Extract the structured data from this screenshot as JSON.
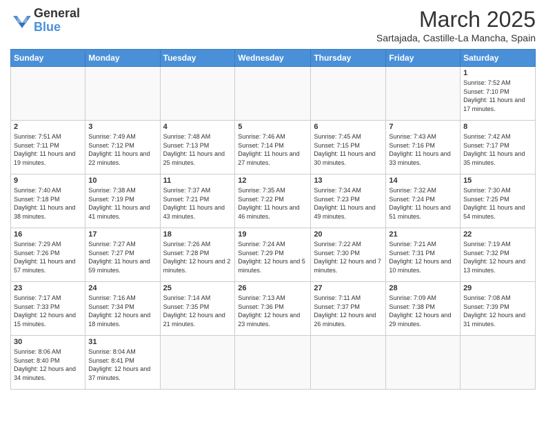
{
  "logo": {
    "text_general": "General",
    "text_blue": "Blue"
  },
  "header": {
    "month_title": "March 2025",
    "location": "Sartajada, Castille-La Mancha, Spain"
  },
  "weekdays": [
    "Sunday",
    "Monday",
    "Tuesday",
    "Wednesday",
    "Thursday",
    "Friday",
    "Saturday"
  ],
  "weeks": [
    [
      {
        "num": "",
        "info": ""
      },
      {
        "num": "",
        "info": ""
      },
      {
        "num": "",
        "info": ""
      },
      {
        "num": "",
        "info": ""
      },
      {
        "num": "",
        "info": ""
      },
      {
        "num": "",
        "info": ""
      },
      {
        "num": "1",
        "info": "Sunrise: 7:52 AM\nSunset: 7:10 PM\nDaylight: 11 hours\nand 17 minutes."
      }
    ],
    [
      {
        "num": "2",
        "info": "Sunrise: 7:51 AM\nSunset: 7:11 PM\nDaylight: 11 hours\nand 19 minutes."
      },
      {
        "num": "3",
        "info": "Sunrise: 7:49 AM\nSunset: 7:12 PM\nDaylight: 11 hours\nand 22 minutes."
      },
      {
        "num": "4",
        "info": "Sunrise: 7:48 AM\nSunset: 7:13 PM\nDaylight: 11 hours\nand 25 minutes."
      },
      {
        "num": "5",
        "info": "Sunrise: 7:46 AM\nSunset: 7:14 PM\nDaylight: 11 hours\nand 27 minutes."
      },
      {
        "num": "6",
        "info": "Sunrise: 7:45 AM\nSunset: 7:15 PM\nDaylight: 11 hours\nand 30 minutes."
      },
      {
        "num": "7",
        "info": "Sunrise: 7:43 AM\nSunset: 7:16 PM\nDaylight: 11 hours\nand 33 minutes."
      },
      {
        "num": "8",
        "info": "Sunrise: 7:42 AM\nSunset: 7:17 PM\nDaylight: 11 hours\nand 35 minutes."
      }
    ],
    [
      {
        "num": "9",
        "info": "Sunrise: 7:40 AM\nSunset: 7:18 PM\nDaylight: 11 hours\nand 38 minutes."
      },
      {
        "num": "10",
        "info": "Sunrise: 7:38 AM\nSunset: 7:19 PM\nDaylight: 11 hours\nand 41 minutes."
      },
      {
        "num": "11",
        "info": "Sunrise: 7:37 AM\nSunset: 7:21 PM\nDaylight: 11 hours\nand 43 minutes."
      },
      {
        "num": "12",
        "info": "Sunrise: 7:35 AM\nSunset: 7:22 PM\nDaylight: 11 hours\nand 46 minutes."
      },
      {
        "num": "13",
        "info": "Sunrise: 7:34 AM\nSunset: 7:23 PM\nDaylight: 11 hours\nand 49 minutes."
      },
      {
        "num": "14",
        "info": "Sunrise: 7:32 AM\nSunset: 7:24 PM\nDaylight: 11 hours\nand 51 minutes."
      },
      {
        "num": "15",
        "info": "Sunrise: 7:30 AM\nSunset: 7:25 PM\nDaylight: 11 hours\nand 54 minutes."
      }
    ],
    [
      {
        "num": "16",
        "info": "Sunrise: 7:29 AM\nSunset: 7:26 PM\nDaylight: 11 hours\nand 57 minutes."
      },
      {
        "num": "17",
        "info": "Sunrise: 7:27 AM\nSunset: 7:27 PM\nDaylight: 11 hours\nand 59 minutes."
      },
      {
        "num": "18",
        "info": "Sunrise: 7:26 AM\nSunset: 7:28 PM\nDaylight: 12 hours\nand 2 minutes."
      },
      {
        "num": "19",
        "info": "Sunrise: 7:24 AM\nSunset: 7:29 PM\nDaylight: 12 hours\nand 5 minutes."
      },
      {
        "num": "20",
        "info": "Sunrise: 7:22 AM\nSunset: 7:30 PM\nDaylight: 12 hours\nand 7 minutes."
      },
      {
        "num": "21",
        "info": "Sunrise: 7:21 AM\nSunset: 7:31 PM\nDaylight: 12 hours\nand 10 minutes."
      },
      {
        "num": "22",
        "info": "Sunrise: 7:19 AM\nSunset: 7:32 PM\nDaylight: 12 hours\nand 13 minutes."
      }
    ],
    [
      {
        "num": "23",
        "info": "Sunrise: 7:17 AM\nSunset: 7:33 PM\nDaylight: 12 hours\nand 15 minutes."
      },
      {
        "num": "24",
        "info": "Sunrise: 7:16 AM\nSunset: 7:34 PM\nDaylight: 12 hours\nand 18 minutes."
      },
      {
        "num": "25",
        "info": "Sunrise: 7:14 AM\nSunset: 7:35 PM\nDaylight: 12 hours\nand 21 minutes."
      },
      {
        "num": "26",
        "info": "Sunrise: 7:13 AM\nSunset: 7:36 PM\nDaylight: 12 hours\nand 23 minutes."
      },
      {
        "num": "27",
        "info": "Sunrise: 7:11 AM\nSunset: 7:37 PM\nDaylight: 12 hours\nand 26 minutes."
      },
      {
        "num": "28",
        "info": "Sunrise: 7:09 AM\nSunset: 7:38 PM\nDaylight: 12 hours\nand 29 minutes."
      },
      {
        "num": "29",
        "info": "Sunrise: 7:08 AM\nSunset: 7:39 PM\nDaylight: 12 hours\nand 31 minutes."
      }
    ],
    [
      {
        "num": "30",
        "info": "Sunrise: 8:06 AM\nSunset: 8:40 PM\nDaylight: 12 hours\nand 34 minutes."
      },
      {
        "num": "31",
        "info": "Sunrise: 8:04 AM\nSunset: 8:41 PM\nDaylight: 12 hours\nand 37 minutes."
      },
      {
        "num": "",
        "info": ""
      },
      {
        "num": "",
        "info": ""
      },
      {
        "num": "",
        "info": ""
      },
      {
        "num": "",
        "info": ""
      },
      {
        "num": "",
        "info": ""
      }
    ]
  ]
}
